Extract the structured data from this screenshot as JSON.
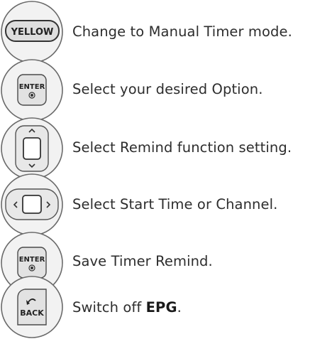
{
  "steps": [
    {
      "button": "YELLOW",
      "button_label": "YELLOW",
      "text": "Change to Manual Timer mode."
    },
    {
      "button": "ENTER",
      "button_label": "ENTER",
      "text": "Select your desired Option."
    },
    {
      "button": "up-down-icon",
      "button_label": "",
      "text": "Select Remind function setting."
    },
    {
      "button": "left-right-icon",
      "button_label": "",
      "text": "Select Start Time or Channel."
    },
    {
      "button": "ENTER",
      "button_label": "ENTER",
      "text": "Save Timer Remind."
    },
    {
      "button": "BACK",
      "button_label": "BACK",
      "text_prefix": "Switch off ",
      "text_bold": "EPG",
      "text_suffix": "."
    }
  ]
}
